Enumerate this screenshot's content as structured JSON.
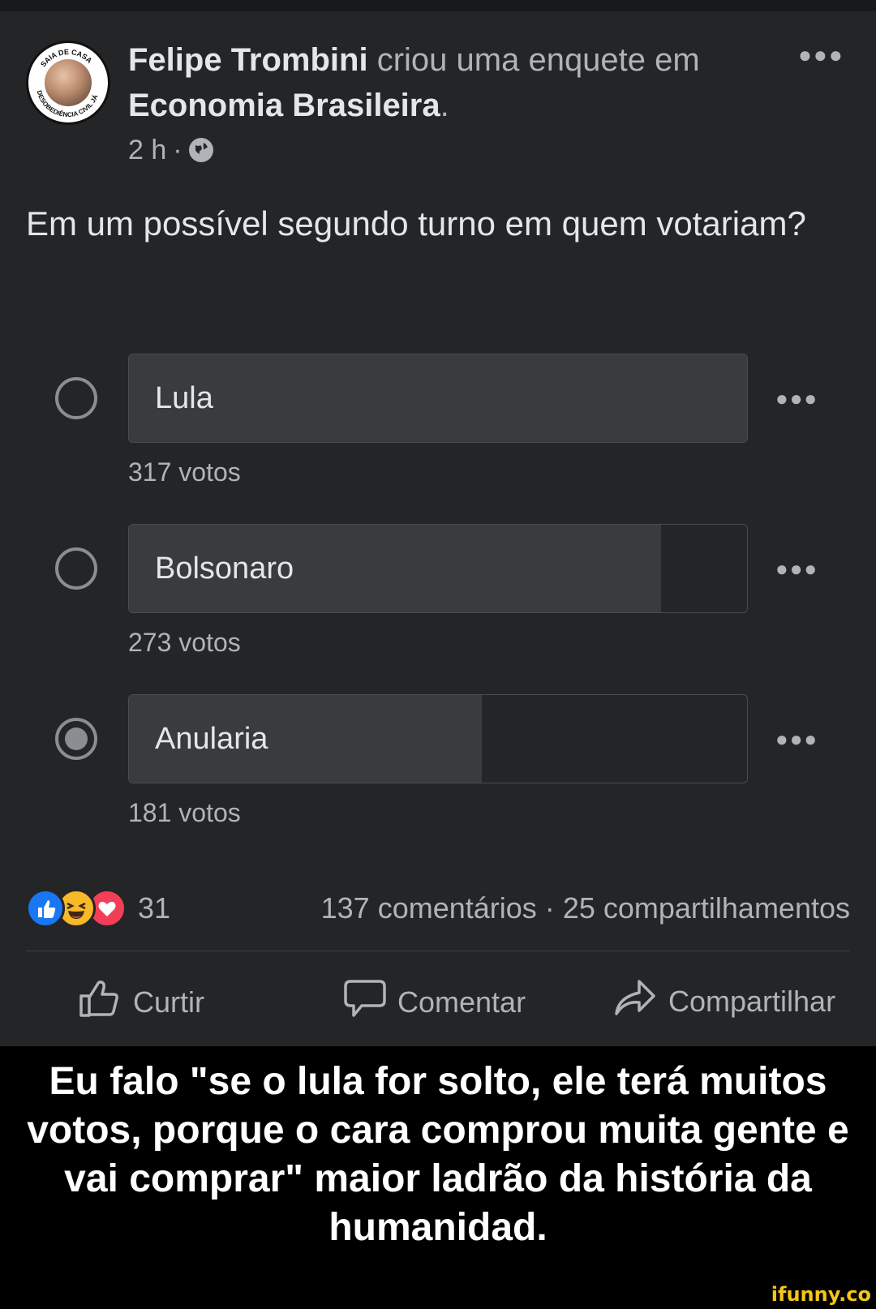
{
  "post": {
    "author": "Felipe Trombini",
    "action_text": " criou uma enquete em ",
    "group": "Economia Brasileira",
    "period": ".",
    "time": "2 h",
    "dot": "·",
    "more_icon": "more-icon",
    "avatar_ring_top": "SAIA DE CASA",
    "avatar_ring_bottom": "DESOBEDIÊNCIA CIVIL JÁ",
    "question": "Em um possível segundo turno em quem votariam?"
  },
  "poll": {
    "options": [
      {
        "label": "Lula",
        "votes_text": "317 votos",
        "votes": 317,
        "selected": false
      },
      {
        "label": "Bolsonaro",
        "votes_text": "273 votos",
        "votes": 273,
        "selected": false
      },
      {
        "label": "Anularia",
        "votes_text": "181 votos",
        "votes": 181,
        "selected": true
      }
    ]
  },
  "footer": {
    "reaction_count": "31",
    "comments": "137 comentários",
    "separator": "·",
    "shares": "25 compartilhamentos",
    "like": "Curtir",
    "comment": "Comentar",
    "share": "Compartilhar"
  },
  "caption": "Eu falo \"se o lula for solto, ele terá muitos votos, porque o cara comprou muita gente e vai comprar\" maior ladrão da história da humanidad.",
  "watermark": "ifunny.co",
  "colors": {
    "card": "#242526",
    "bar_fill": "#3a3b3c",
    "text": "#e4e6eb",
    "muted": "#b0b3b8",
    "watermark": "#f5c518"
  }
}
